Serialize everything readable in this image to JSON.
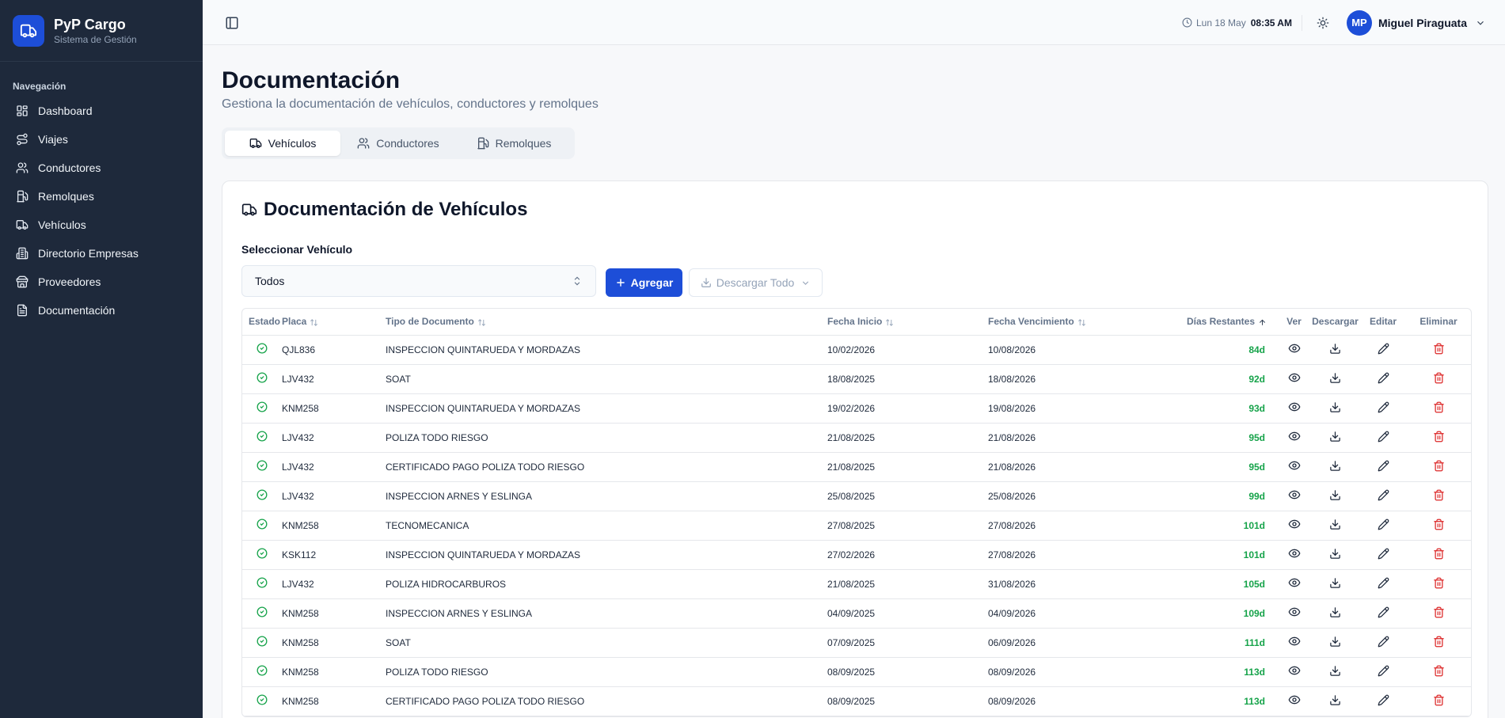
{
  "app": {
    "name": "PyP Cargo",
    "subtitle": "Sistema de Gestión"
  },
  "sidebar": {
    "section_title": "Navegación",
    "items": [
      {
        "label": "Dashboard",
        "icon": "dashboard-icon"
      },
      {
        "label": "Viajes",
        "icon": "route-icon"
      },
      {
        "label": "Conductores",
        "icon": "users-icon"
      },
      {
        "label": "Remolques",
        "icon": "fuel-icon"
      },
      {
        "label": "Vehículos",
        "icon": "truck-icon"
      },
      {
        "label": "Directorio Empresas",
        "icon": "building-icon"
      },
      {
        "label": "Proveedores",
        "icon": "store-icon"
      },
      {
        "label": "Documentación",
        "icon": "file-icon"
      }
    ]
  },
  "header": {
    "date": "Lun 18 May",
    "time": "08:35 AM",
    "user_initials": "MP",
    "user_name": "Miguel Piraguata"
  },
  "page": {
    "title": "Documentación",
    "subtitle": "Gestiona la documentación de vehículos, conductores y remolques",
    "tabs": [
      {
        "label": "Vehículos",
        "active": true
      },
      {
        "label": "Conductores",
        "active": false
      },
      {
        "label": "Remolques",
        "active": false
      }
    ]
  },
  "card": {
    "title": "Documentación de Vehículos",
    "select_label": "Seleccionar Vehículo",
    "select_value": "Todos",
    "add_label": "Agregar",
    "download_all_label": "Descargar Todo"
  },
  "table": {
    "columns": {
      "estado": "Estado",
      "placa": "Placa",
      "tipo": "Tipo de Documento",
      "inicio": "Fecha Inicio",
      "vencimiento": "Fecha Vencimiento",
      "dias": "Días Restantes",
      "ver": "Ver",
      "descargar": "Descargar",
      "editar": "Editar",
      "eliminar": "Eliminar"
    },
    "rows": [
      {
        "placa": "QJL836",
        "tipo": "INSPECCION QUINTARUEDA Y MORDAZAS",
        "inicio": "10/02/2026",
        "vencimiento": "10/08/2026",
        "dias": "84d"
      },
      {
        "placa": "LJV432",
        "tipo": "SOAT",
        "inicio": "18/08/2025",
        "vencimiento": "18/08/2026",
        "dias": "92d"
      },
      {
        "placa": "KNM258",
        "tipo": "INSPECCION QUINTARUEDA Y MORDAZAS",
        "inicio": "19/02/2026",
        "vencimiento": "19/08/2026",
        "dias": "93d"
      },
      {
        "placa": "LJV432",
        "tipo": "POLIZA TODO RIESGO",
        "inicio": "21/08/2025",
        "vencimiento": "21/08/2026",
        "dias": "95d"
      },
      {
        "placa": "LJV432",
        "tipo": "CERTIFICADO PAGO POLIZA TODO RIESGO",
        "inicio": "21/08/2025",
        "vencimiento": "21/08/2026",
        "dias": "95d"
      },
      {
        "placa": "LJV432",
        "tipo": "INSPECCION ARNES Y ESLINGA",
        "inicio": "25/08/2025",
        "vencimiento": "25/08/2026",
        "dias": "99d"
      },
      {
        "placa": "KNM258",
        "tipo": "TECNOMECANICA",
        "inicio": "27/08/2025",
        "vencimiento": "27/08/2026",
        "dias": "101d"
      },
      {
        "placa": "KSK112",
        "tipo": "INSPECCION QUINTARUEDA Y MORDAZAS",
        "inicio": "27/02/2026",
        "vencimiento": "27/08/2026",
        "dias": "101d"
      },
      {
        "placa": "LJV432",
        "tipo": "POLIZA HIDROCARBUROS",
        "inicio": "21/08/2025",
        "vencimiento": "31/08/2026",
        "dias": "105d"
      },
      {
        "placa": "KNM258",
        "tipo": "INSPECCION ARNES Y ESLINGA",
        "inicio": "04/09/2025",
        "vencimiento": "04/09/2026",
        "dias": "109d"
      },
      {
        "placa": "KNM258",
        "tipo": "SOAT",
        "inicio": "07/09/2025",
        "vencimiento": "06/09/2026",
        "dias": "111d"
      },
      {
        "placa": "KNM258",
        "tipo": "POLIZA TODO RIESGO",
        "inicio": "08/09/2025",
        "vencimiento": "08/09/2026",
        "dias": "113d"
      },
      {
        "placa": "KNM258",
        "tipo": "CERTIFICADO PAGO POLIZA TODO RIESGO",
        "inicio": "08/09/2025",
        "vencimiento": "08/09/2026",
        "dias": "113d"
      }
    ]
  },
  "colors": {
    "sidebar_bg": "#1e293b",
    "primary": "#1d4ed8",
    "status_ok": "#16a34a",
    "delete": "#dc2626"
  }
}
